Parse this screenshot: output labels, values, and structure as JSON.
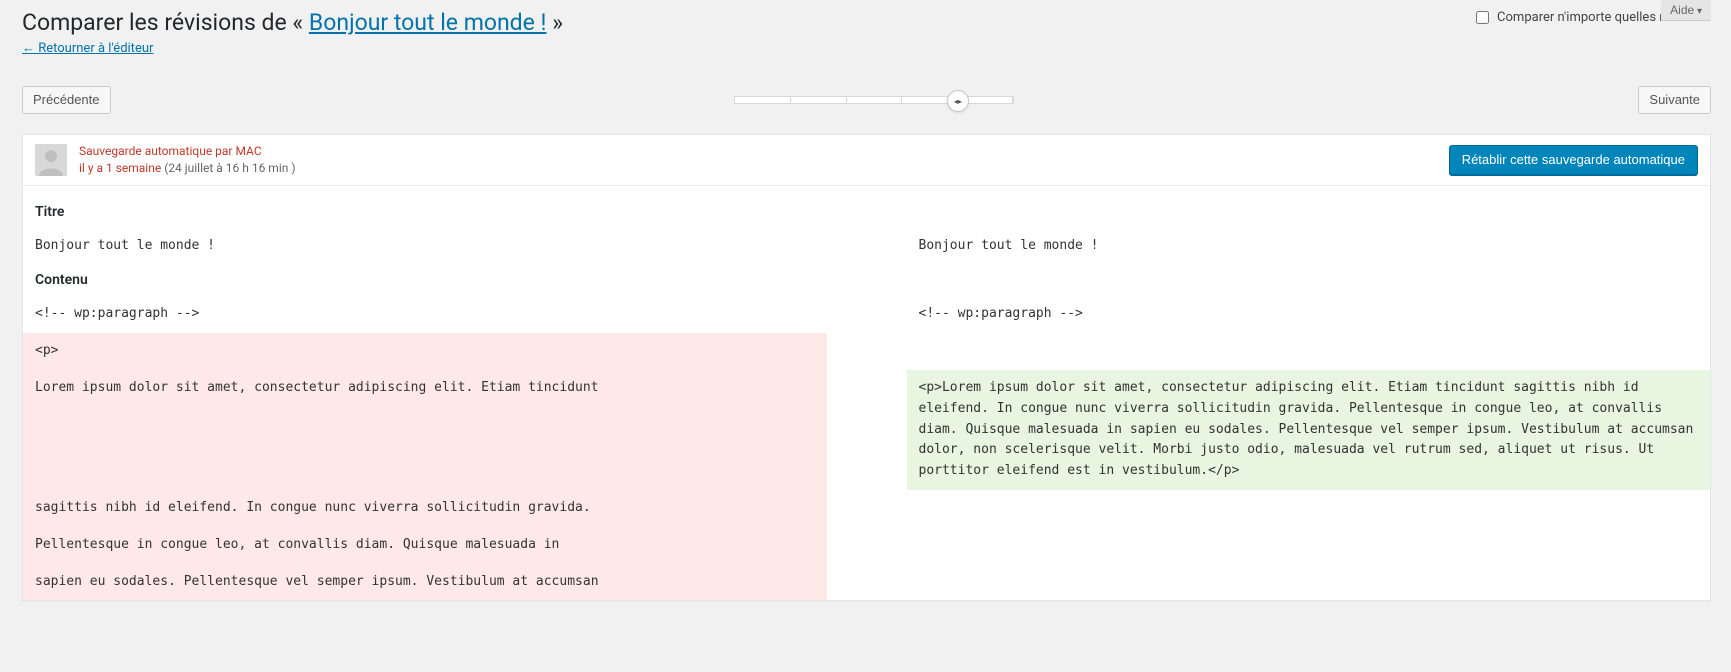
{
  "help_label": "Aide",
  "heading": {
    "prefix": "Comparer les révisions de « ",
    "link": "Bonjour tout le monde !",
    "suffix": " »"
  },
  "back_link": "← Retourner à l'éditeur",
  "compare_any_label": "Comparer n'importe quelles révisions",
  "nav": {
    "prev": "Précédente",
    "next": "Suivante"
  },
  "revision": {
    "autosave_by": "Sauvegarde automatique par MAC",
    "ago": "il y a 1 semaine",
    "date": " (24 juillet à 16 h 16 min )",
    "restore_label": "Rétablir cette sauvegarde automatique"
  },
  "sections": {
    "title_label": "Titre",
    "content_label": "Contenu"
  },
  "diff": {
    "title_left": "Bonjour tout le monde !",
    "title_right": "Bonjour tout le monde !",
    "paragraph_open_left": "<!-- wp:paragraph -->",
    "paragraph_open_right": "<!-- wp:paragraph -->",
    "p_open": "<p>",
    "old_line1": "Lorem ipsum dolor sit amet, consectetur adipiscing elit. Etiam tincidunt",
    "new_block": "<p>Lorem ipsum dolor sit amet, consectetur adipiscing elit. Etiam tincidunt sagittis nibh id eleifend. In congue nunc viverra sollicitudin gravida. Pellentesque in congue leo, at convallis diam. Quisque malesuada in sapien eu sodales. Pellentesque vel semper ipsum. Vestibulum at accumsan dolor, non scelerisque velit. Morbi justo odio, malesuada vel rutrum sed, aliquet ut risus. Ut porttitor eleifend est in vestibulum.</p>",
    "old_line2": " sagittis nibh id eleifend. In congue nunc viverra sollicitudin gravida.",
    "old_line3": " Pellentesque in congue leo, at convallis diam. Quisque malesuada in",
    "old_line4": "sapien eu sodales. Pellentesque vel semper ipsum. Vestibulum at accumsan"
  }
}
